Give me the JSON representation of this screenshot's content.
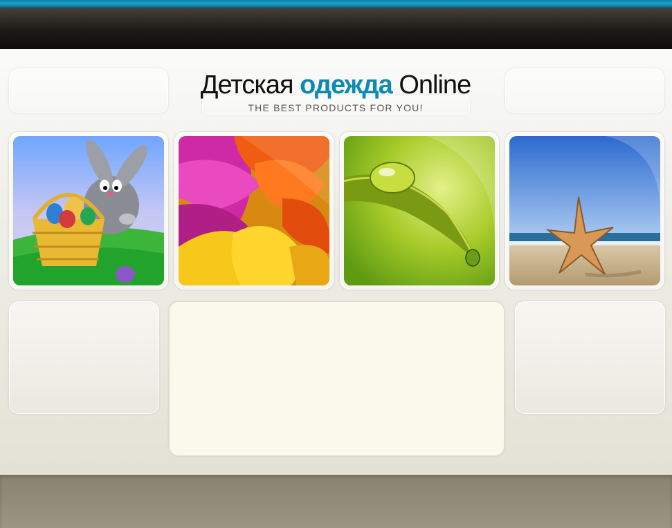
{
  "header": {
    "logo_part1": "Детская ",
    "logo_accent": "одежда",
    "logo_part2": " Online",
    "slogan": "THE BEST PRODUCTS FOR YOU!"
  },
  "colors": {
    "accent": "#0c8ab3",
    "top_bar": "#1c1a17",
    "footer": "#948d78"
  },
  "gallery": [
    {
      "subject": "easter-bunny-basket"
    },
    {
      "subject": "flower-petals"
    },
    {
      "subject": "water-drop-leaf"
    },
    {
      "subject": "starfish-beach"
    }
  ]
}
